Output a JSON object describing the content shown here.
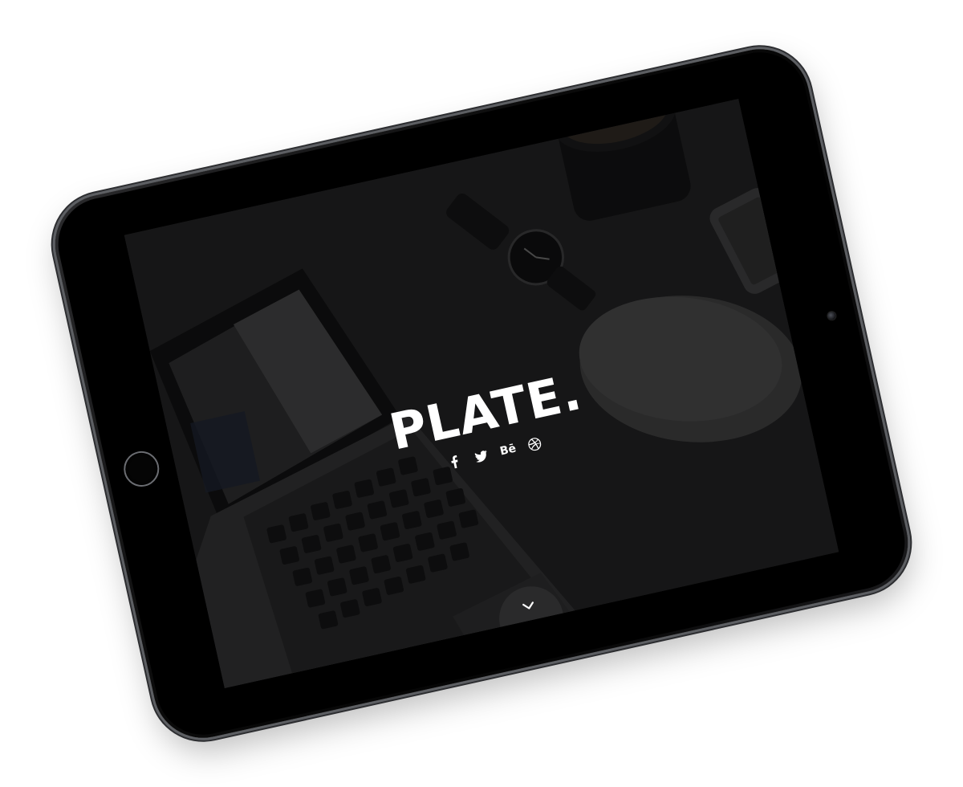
{
  "hero": {
    "logo_text": "PLATE."
  },
  "social": [
    {
      "name": "facebook",
      "icon": "facebook-icon"
    },
    {
      "name": "twitter",
      "icon": "twitter-icon"
    },
    {
      "name": "behance",
      "icon": "behance-icon",
      "glyph": "Bē"
    },
    {
      "name": "dribbble",
      "icon": "dribbble-icon"
    }
  ],
  "scroll": {
    "icon": "chevron-down-icon"
  },
  "colors": {
    "screen_bg": "#1b1b1c",
    "text": "#ffffff",
    "device_frame": "#0a0a0a",
    "device_edge": "#5d5f63"
  }
}
